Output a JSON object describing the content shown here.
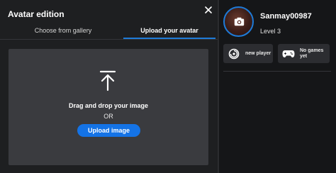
{
  "modal": {
    "title": "Avatar edition",
    "tabs": [
      {
        "label": "Choose from gallery",
        "active": false
      },
      {
        "label": "Upload your avatar",
        "active": true
      }
    ],
    "dropzone": {
      "icon": "upload-arrow-icon",
      "drag_text": "Drag and drop your image",
      "or_text": "OR",
      "button_label": "Upload image"
    },
    "close_icon": "close-icon"
  },
  "profile": {
    "username": "Sanmay00987",
    "level": "Level 3",
    "avatar_icon": "camera-icon",
    "badges": [
      {
        "icon": "ubisoft-logo-icon",
        "label": "new player"
      },
      {
        "icon": "gamepad-icon",
        "label_line1": "No games",
        "label_line2": "yet"
      }
    ]
  },
  "colors": {
    "accent": "#1473e6",
    "tab_underline": "#1e7bd8",
    "background": "#1e1f21",
    "dropzone": "#3a3b3f"
  }
}
